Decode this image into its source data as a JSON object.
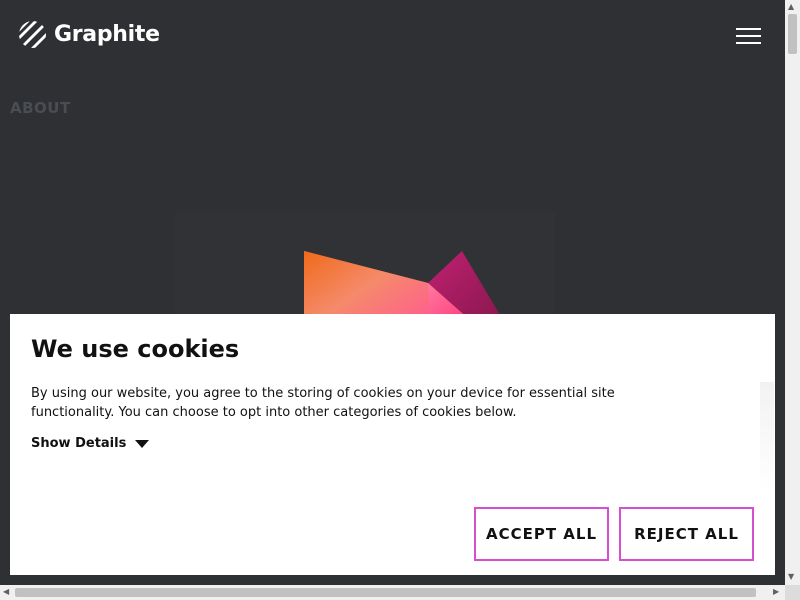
{
  "header": {
    "brand_name": "Graphite",
    "logo_icon": "striped-logo-icon",
    "menu_icon": "hamburger-menu-icon"
  },
  "page": {
    "section_label": "ABOUT"
  },
  "cookie_banner": {
    "title": "We use cookies",
    "body": "By using our website, you agree to the storing of cookies on your device for essential site functionality. You can choose to opt into other categories of cookies below.",
    "show_details_label": "Show Details",
    "accept_label": "ACCEPT ALL",
    "reject_label": "REJECT ALL",
    "button_border_color": "#d64fd0"
  },
  "colors": {
    "background": "#2e3033",
    "text_light": "#ffffff",
    "accent_orange": "#f06a1a",
    "accent_pink": "#ff6a8a",
    "accent_magenta": "#b0206a"
  },
  "scrollbars": {
    "up_arrow": "▲",
    "down_arrow": "▼",
    "left_arrow": "◀",
    "right_arrow": "▶"
  }
}
